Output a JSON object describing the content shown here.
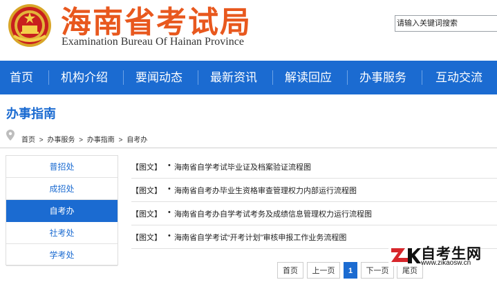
{
  "header": {
    "title": "海南省考试局",
    "subtitle": "Examination Bureau Of Hainan Province",
    "search_placeholder": "请输入关键词搜索"
  },
  "nav": {
    "items": [
      "首页",
      "机构介绍",
      "要闻动态",
      "最新资讯",
      "解读回应",
      "办事服务",
      "互动交流"
    ]
  },
  "page": {
    "title": "办事指南",
    "breadcrumb": [
      "首页",
      ">",
      "办事服务",
      ">",
      "办事指南",
      ">",
      "自考办"
    ]
  },
  "sidebar": {
    "items": [
      "普招处",
      "成招处",
      "自考办",
      "社考处",
      "学考处"
    ],
    "active": "自考办"
  },
  "list": {
    "tag": "【图文】",
    "bullet": "•",
    "items": [
      "海南省自学考试毕业证及档案验证流程图",
      "海南省自考办毕业生资格审查管理权力内部运行流程图",
      "海南省自考办自学考试考务及成绩信息管理权力运行流程图",
      "海南省自学考试“开考计划”审核申报工作业务流程图"
    ]
  },
  "pagination": {
    "first": "首页",
    "prev": "上一页",
    "current": "1",
    "next": "下一页",
    "last": "尾页"
  },
  "watermark": {
    "name": "自考生网",
    "url": "www.zikaosw.cn"
  },
  "colors": {
    "brand_blue": "#1b6bd1",
    "title_orange": "#e8581e",
    "watermark_red": "#d7262b"
  }
}
